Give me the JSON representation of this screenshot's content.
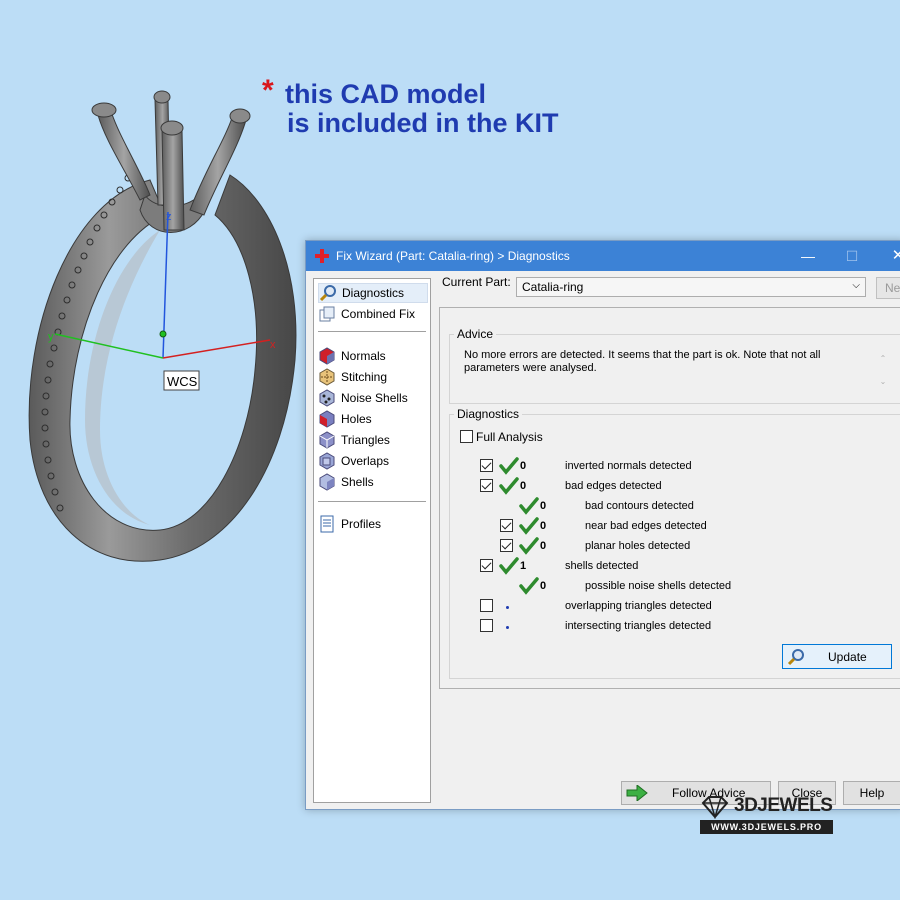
{
  "promo": {
    "star": "*",
    "line1": "this CAD model",
    "line2": "is included in the KIT"
  },
  "viewport": {
    "wcs_label": "WCS",
    "axis_x": "x",
    "axis_y": "y",
    "axis_z": "z"
  },
  "window": {
    "title": "Fix Wizard (Part: Catalia-ring) > Diagnostics",
    "min_glyph": "—",
    "max_glyph": "☐",
    "close_glyph": "✕"
  },
  "nav": {
    "items": [
      {
        "label": "Diagnostics",
        "icon": "magnifier-icon"
      },
      {
        "label": "Combined Fix",
        "icon": "combined-fix-icon"
      },
      {
        "label": "Normals",
        "icon": "normals-icon"
      },
      {
        "label": "Stitching",
        "icon": "stitching-icon"
      },
      {
        "label": "Noise Shells",
        "icon": "noise-shells-icon"
      },
      {
        "label": "Holes",
        "icon": "holes-icon"
      },
      {
        "label": "Triangles",
        "icon": "triangles-icon"
      },
      {
        "label": "Overlaps",
        "icon": "overlaps-icon"
      },
      {
        "label": "Shells",
        "icon": "shells-icon"
      },
      {
        "label": "Profiles",
        "icon": "profiles-icon"
      }
    ]
  },
  "current_part": {
    "label": "Current Part:",
    "value": "Catalia-ring",
    "next_label": "Nex"
  },
  "advice": {
    "title": "Advice",
    "text": "No more errors are detected. It seems that the part is ok. Note that not all parameters were analysed."
  },
  "diagnostics": {
    "title": "Diagnostics",
    "full_analysis_label": "Full Analysis",
    "full_analysis_checked": false,
    "rows": [
      {
        "label": "inverted normals detected",
        "count": "0"
      },
      {
        "label": "bad edges detected",
        "count": "0"
      },
      {
        "label": "bad contours detected",
        "count": "0"
      },
      {
        "label": "near bad edges detected",
        "count": "0"
      },
      {
        "label": "planar holes detected",
        "count": "0"
      },
      {
        "label": "shells detected",
        "count": "1"
      },
      {
        "label": "possible noise shells detected",
        "count": "0"
      },
      {
        "label": "overlapping triangles detected",
        "count": ""
      },
      {
        "label": "intersecting triangles detected",
        "count": ""
      }
    ]
  },
  "buttons": {
    "update": "Update",
    "follow_advice": "Follow Advice",
    "close": "Close",
    "help": "Help"
  },
  "watermark": {
    "brand": "3DJEWELS",
    "url": "WWW.3DJEWELS.PRO"
  },
  "colors": {
    "titlebar": "#3c82d6",
    "promo_text": "#1f3bb0",
    "star": "#d9171c",
    "check_green": "#2e8b2e",
    "background": "#bcddf6"
  }
}
